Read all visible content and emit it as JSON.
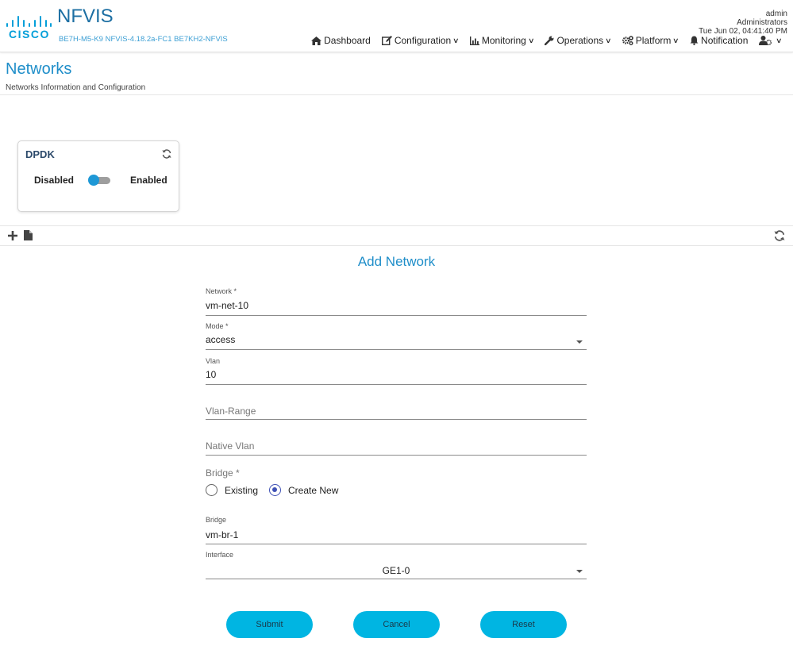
{
  "header": {
    "logo_text": "CISCO",
    "product": "NFVIS",
    "device": "BE7H-M5-K9 NFVIS-4.18.2a-FC1 BE7KH2-NFVIS",
    "user": {
      "name": "admin",
      "role": "Administrators",
      "datetime": "Tue Jun 02, 04:41:40 PM"
    },
    "nav": [
      {
        "label": "Dashboard",
        "icon": "home-icon",
        "dropdown": false
      },
      {
        "label": "Configuration",
        "icon": "edit-icon",
        "dropdown": true
      },
      {
        "label": "Monitoring",
        "icon": "bar-chart-icon",
        "dropdown": true
      },
      {
        "label": "Operations",
        "icon": "wrench-icon",
        "dropdown": true
      },
      {
        "label": "Platform",
        "icon": "gears-icon",
        "dropdown": true
      },
      {
        "label": "Notification",
        "icon": "bell-icon",
        "dropdown": false
      },
      {
        "label": "",
        "icon": "user-settings-icon",
        "dropdown": true
      }
    ]
  },
  "page": {
    "title": "Networks",
    "subtitle": "Networks Information and Configuration"
  },
  "dpdk": {
    "title": "DPDK",
    "disabled_label": "Disabled",
    "enabled_label": "Enabled",
    "state": "disabled"
  },
  "form": {
    "title": "Add Network",
    "network": {
      "label": "Network *",
      "value": "vm-net-10"
    },
    "mode": {
      "label": "Mode *",
      "value": "access"
    },
    "vlan": {
      "label": "Vlan",
      "value": "10"
    },
    "vlan_range": {
      "placeholder": "Vlan-Range",
      "value": ""
    },
    "native_vlan": {
      "placeholder": "Native Vlan",
      "value": ""
    },
    "bridge_choice": {
      "label": "Bridge *",
      "options": [
        "Existing",
        "Create New"
      ],
      "selected": "Create New"
    },
    "bridge": {
      "label": "Bridge",
      "value": "vm-br-1"
    },
    "interface": {
      "label": "Interface",
      "value": "GE1-0"
    },
    "buttons": {
      "submit": "Submit",
      "cancel": "Cancel",
      "reset": "Reset"
    }
  },
  "colors": {
    "accent": "#1f8ec9",
    "button": "#00b5e2",
    "radio_selected": "#3f51b5",
    "toggle_knob": "#1e98d6"
  }
}
